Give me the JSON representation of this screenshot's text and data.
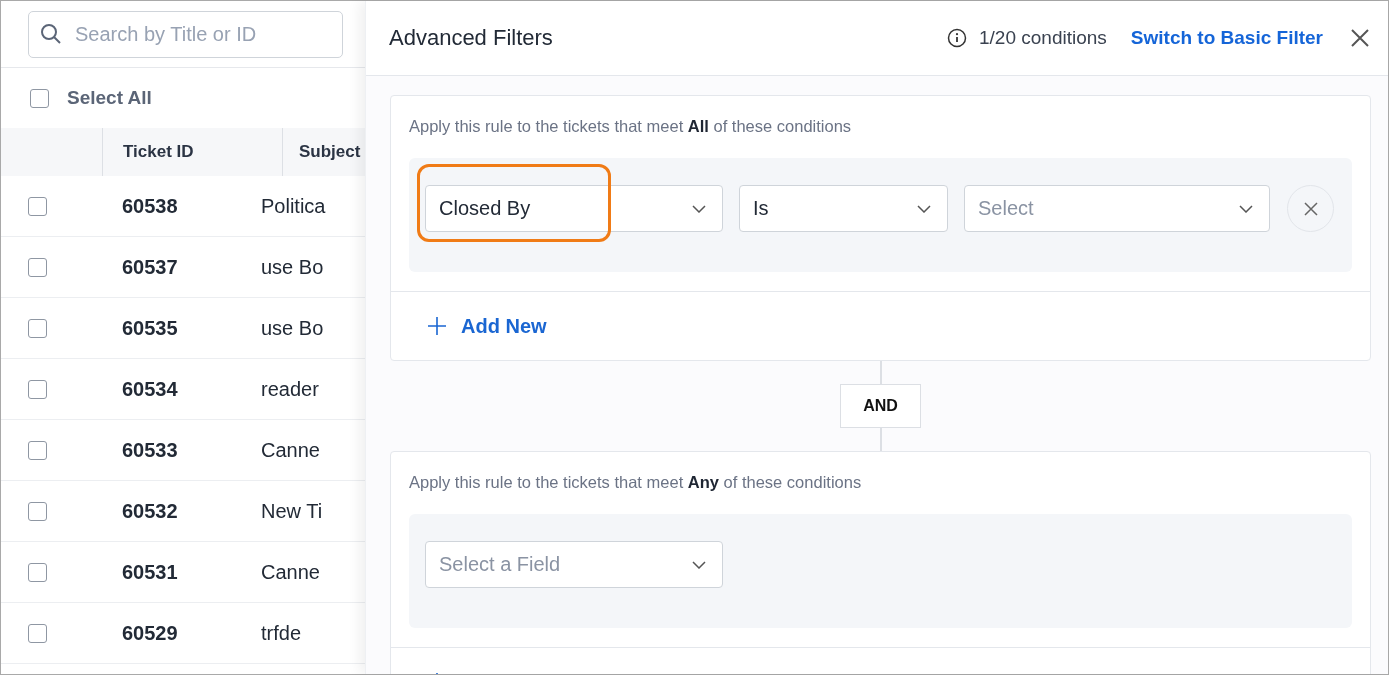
{
  "search": {
    "placeholder": "Search by Title or ID"
  },
  "select_all": {
    "label": "Select All",
    "checked": false
  },
  "table": {
    "columns": [
      "Ticket ID",
      "Subject"
    ],
    "rows": [
      {
        "ticket_id": "60538",
        "subject": "Politica",
        "checked": false
      },
      {
        "ticket_id": "60537",
        "subject": "use Bo",
        "checked": false
      },
      {
        "ticket_id": "60535",
        "subject": "use Bo",
        "checked": false
      },
      {
        "ticket_id": "60534",
        "subject": "reader",
        "checked": false
      },
      {
        "ticket_id": "60533",
        "subject": "Canne",
        "checked": false
      },
      {
        "ticket_id": "60532",
        "subject": "New Ti",
        "checked": false
      },
      {
        "ticket_id": "60531",
        "subject": "Canne",
        "checked": false
      },
      {
        "ticket_id": "60529",
        "subject": "trfde",
        "checked": false
      }
    ]
  },
  "drawer": {
    "title": "Advanced Filters",
    "conditions_count": "1/20 conditions",
    "switch_link": "Switch to Basic Filter",
    "groups": [
      {
        "rule_text": "Apply this rule to the tickets that meet **All** of these conditions",
        "conditions": [
          {
            "field": {
              "value": "Closed By",
              "highlighted": true
            },
            "operator": {
              "value": "Is"
            },
            "value": {
              "placeholder": "Select"
            },
            "removable": true
          }
        ],
        "add_label": "Add New"
      },
      {
        "rule_text": "Apply this rule to the tickets that meet **Any** of these conditions",
        "conditions": [
          {
            "field": {
              "placeholder": "Select a Field"
            }
          }
        ]
      }
    ],
    "join": "AND"
  }
}
